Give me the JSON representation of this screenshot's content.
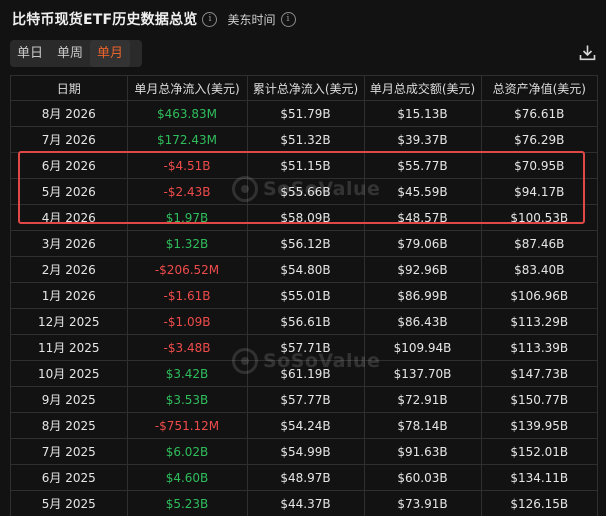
{
  "header": {
    "title": "比特币现货ETF历史数据总览",
    "info_icon": "info-circle-icon",
    "timezone": "美东时间"
  },
  "toggle": {
    "options": [
      "单日",
      "单周",
      "单月"
    ],
    "active": "单月"
  },
  "download_icon": "download-icon",
  "table": {
    "columns": [
      "日期",
      "单月总净流入(美元)",
      "累计总净流入(美元)",
      "单月总成交额(美元)",
      "总资产净值(美元)"
    ],
    "rows": [
      {
        "date": "8月 2026",
        "net_inflow": "$463.83M",
        "cumulative": "$51.79B",
        "volume": "$15.13B",
        "nav": "$76.61B"
      },
      {
        "date": "7月 2026",
        "net_inflow": "$172.43M",
        "cumulative": "$51.32B",
        "volume": "$39.37B",
        "nav": "$76.29B"
      },
      {
        "date": "6月 2026",
        "net_inflow": "-$4.51B",
        "cumulative": "$51.15B",
        "volume": "$55.77B",
        "nav": "$70.95B"
      },
      {
        "date": "5月 2026",
        "net_inflow": "-$2.43B",
        "cumulative": "$55.66B",
        "volume": "$45.59B",
        "nav": "$94.17B"
      },
      {
        "date": "4月 2026",
        "net_inflow": "$1.97B",
        "cumulative": "$58.09B",
        "volume": "$48.57B",
        "nav": "$100.53B"
      },
      {
        "date": "3月 2026",
        "net_inflow": "$1.32B",
        "cumulative": "$56.12B",
        "volume": "$79.06B",
        "nav": "$87.46B"
      },
      {
        "date": "2月 2026",
        "net_inflow": "-$206.52M",
        "cumulative": "$54.80B",
        "volume": "$92.96B",
        "nav": "$83.40B"
      },
      {
        "date": "1月 2026",
        "net_inflow": "-$1.61B",
        "cumulative": "$55.01B",
        "volume": "$86.99B",
        "nav": "$106.96B"
      },
      {
        "date": "12月 2025",
        "net_inflow": "-$1.09B",
        "cumulative": "$56.61B",
        "volume": "$86.43B",
        "nav": "$113.29B"
      },
      {
        "date": "11月 2025",
        "net_inflow": "-$3.48B",
        "cumulative": "$57.71B",
        "volume": "$109.94B",
        "nav": "$113.39B"
      },
      {
        "date": "10月 2025",
        "net_inflow": "$3.42B",
        "cumulative": "$61.19B",
        "volume": "$137.70B",
        "nav": "$147.73B"
      },
      {
        "date": "9月 2025",
        "net_inflow": "$3.53B",
        "cumulative": "$57.77B",
        "volume": "$72.91B",
        "nav": "$150.77B"
      },
      {
        "date": "8月 2025",
        "net_inflow": "-$751.12M",
        "cumulative": "$54.24B",
        "volume": "$78.14B",
        "nav": "$139.95B"
      },
      {
        "date": "7月 2025",
        "net_inflow": "$6.02B",
        "cumulative": "$54.99B",
        "volume": "$91.63B",
        "nav": "$152.01B"
      },
      {
        "date": "6月 2025",
        "net_inflow": "$4.60B",
        "cumulative": "$48.97B",
        "volume": "$60.03B",
        "nav": "$134.11B"
      },
      {
        "date": "5月 2025",
        "net_inflow": "$5.23B",
        "cumulative": "$44.37B",
        "volume": "$73.91B",
        "nav": "$126.15B"
      }
    ]
  },
  "watermark": {
    "text": "SoSoValue"
  },
  "colors": {
    "positive": "#2fbd5c",
    "negative": "#ef4b4b",
    "accent": "#e8632b",
    "highlight": "#e04848"
  }
}
